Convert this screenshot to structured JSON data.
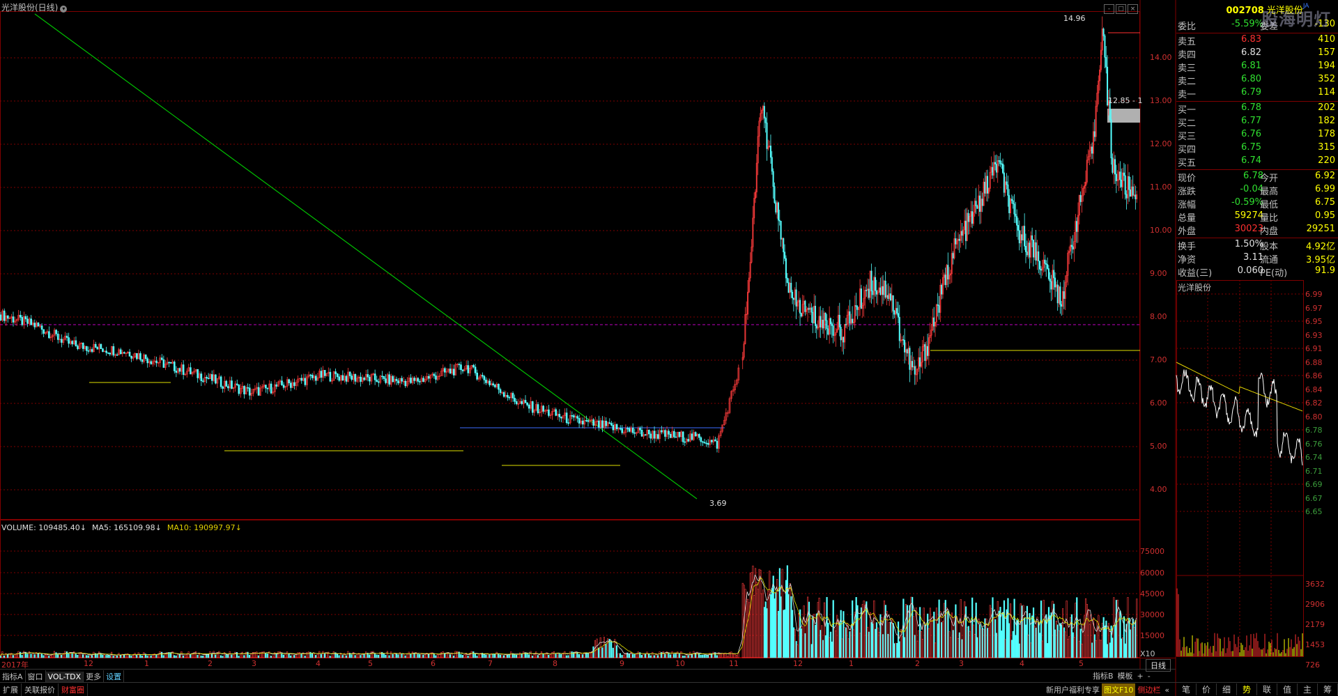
{
  "chart_title": "光洋股份(日线)",
  "window_buttons": [
    "-",
    "□",
    "×"
  ],
  "price_axis": [
    "14.00",
    "13.00",
    "12.00",
    "11.00",
    "10.00",
    "9.00",
    "8.00",
    "7.00",
    "6.00",
    "5.00",
    "4.00"
  ],
  "annotations": {
    "high": "14.96",
    "low": "3.69",
    "high_right": "12.85 - 1"
  },
  "volume_header": {
    "volume": "VOLUME: 109485.40↓",
    "ma5": "MA5: 165109.98↓",
    "ma10": "MA10: 190997.97↓"
  },
  "volume_axis": [
    "75000",
    "60000",
    "45000",
    "30000",
    "15000",
    "X10"
  ],
  "months": [
    "2017年",
    "12",
    "1",
    "2",
    "3",
    "4",
    "5",
    "6",
    "7",
    "8",
    "9",
    "10",
    "11",
    "12",
    "1",
    "2",
    "3",
    "4",
    "5"
  ],
  "period_label": "日线",
  "bottom_tabs_1": [
    "指标A",
    "窗口",
    "VOL-TDX",
    "更多",
    "设置"
  ],
  "bottom_tabs_2": [
    "扩展",
    "关联报价",
    "财富圈"
  ],
  "right_tabs_1": [
    "指标B",
    "模板",
    "+",
    "-"
  ],
  "news_bar": [
    "新用户福利专享",
    "图文F10",
    "侧边栏",
    "«"
  ],
  "panel_tabs": [
    "笔",
    "价",
    "细",
    "势",
    "联",
    "值",
    "主",
    "筹"
  ],
  "quote": {
    "code": "002708",
    "name": "光洋股份",
    "tag": "JA",
    "watermark": "股海明灯",
    "weibi_label": "委比",
    "weibi": "-5.59%",
    "weicha_label": "委差",
    "weicha": "-130",
    "asks": [
      {
        "label": "卖五",
        "price": "6.83",
        "vol": "410"
      },
      {
        "label": "卖四",
        "price": "6.82",
        "vol": "157"
      },
      {
        "label": "卖三",
        "price": "6.81",
        "vol": "194"
      },
      {
        "label": "卖二",
        "price": "6.80",
        "vol": "352"
      },
      {
        "label": "卖一",
        "price": "6.79",
        "vol": "114"
      }
    ],
    "bids": [
      {
        "label": "买一",
        "price": "6.78",
        "vol": "202"
      },
      {
        "label": "买二",
        "price": "6.77",
        "vol": "182"
      },
      {
        "label": "买三",
        "price": "6.76",
        "vol": "178"
      },
      {
        "label": "买四",
        "price": "6.75",
        "vol": "315"
      },
      {
        "label": "买五",
        "price": "6.74",
        "vol": "220"
      }
    ],
    "stats": [
      {
        "l1": "现价",
        "v1": "6.78",
        "l2": "今开",
        "v2": "6.92"
      },
      {
        "l1": "涨跌",
        "v1": "-0.04",
        "l2": "最高",
        "v2": "6.99"
      },
      {
        "l1": "涨幅",
        "v1": "-0.59%",
        "l2": "最低",
        "v2": "6.75"
      },
      {
        "l1": "总量",
        "v1": "59274",
        "l2": "量比",
        "v2": "0.95"
      },
      {
        "l1": "外盘",
        "v1": "30023",
        "l2": "内盘",
        "v2": "29251"
      }
    ],
    "fund": [
      {
        "l1": "换手",
        "v1": "1.50%",
        "l2": "股本",
        "v2": "4.92亿"
      },
      {
        "l1": "净资",
        "v1": "3.11",
        "l2": "流通",
        "v2": "3.95亿"
      },
      {
        "l1": "收益(三)",
        "v1": "0.060",
        "l2": "PE(动)",
        "v2": "91.9"
      }
    ]
  },
  "mini_chart": {
    "title": "光洋股份",
    "price_axis": [
      "6.99",
      "6.97",
      "6.95",
      "6.93",
      "6.91",
      "6.88",
      "6.86",
      "6.84",
      "6.82",
      "6.80",
      "6.78",
      "6.76",
      "6.74",
      "6.71",
      "6.69",
      "6.67",
      "6.65"
    ],
    "vol_axis": [
      "3632",
      "2906",
      "2179",
      "1453",
      "726"
    ]
  },
  "chart_data": {
    "type": "candlestick",
    "symbol": "002708",
    "period": "daily",
    "ylim": [
      3.5,
      15
    ],
    "key_prices": {
      "high": 14.96,
      "low": 3.69,
      "last": 6.78
    },
    "volume": {
      "value": 109485.4,
      "ma5": 165109.98,
      "ma10": 190997.97
    }
  },
  "colors": {
    "up": "#ff3c3c",
    "down": "#54ffff",
    "grid": "#800000",
    "trend": "#00c000",
    "ma": "#e0e000"
  }
}
